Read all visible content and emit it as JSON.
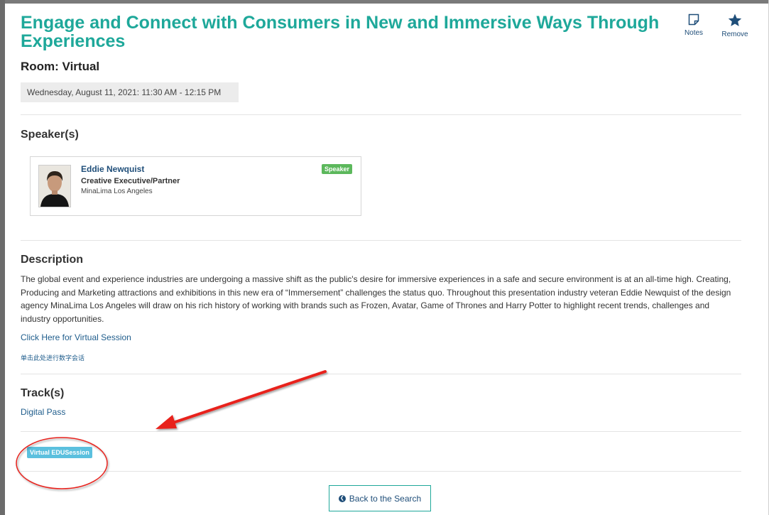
{
  "session": {
    "title": "Engage and Connect with Consumers in New and Immersive Ways Through Experiences",
    "room": "Room: Virtual",
    "datetime": "Wednesday, August 11, 2021: 11:30 AM - 12:15 PM"
  },
  "actions": {
    "notes_label": "Notes",
    "remove_label": "Remove"
  },
  "speakers": {
    "heading": "Speaker(s)",
    "items": [
      {
        "name": "Eddie Newquist",
        "role": "Creative Executive/Partner",
        "org": "MinaLima Los Angeles",
        "badge": "Speaker"
      }
    ]
  },
  "description": {
    "heading": "Description",
    "text": "The global event and experience industries are undergoing a massive shift as the public's desire for immersive experiences in a safe and secure environment is at an all-time high. Creating, Producing and Marketing attractions and exhibitions in this new era of “Immersement” challenges the status quo. Throughout this presentation industry veteran Eddie Newquist of the design agency MinaLima Los Angeles will draw on his rich history of working with brands such as Frozen, Avatar, Game of Thrones and Harry Potter to highlight recent trends, challenges and industry opportunities.",
    "virtual_link": "Click Here for Virtual Session",
    "virtual_link_cn": "单击此处进行数字会话"
  },
  "tracks": {
    "heading": "Track(s)",
    "items": [
      "Digital Pass"
    ]
  },
  "tags": [
    "Virtual EDUSession"
  ],
  "footer": {
    "back_label": "Back to the Search"
  },
  "colors": {
    "title": "#1ea89a",
    "link": "#1f5d8c",
    "speaker_badge": "#5cb85c",
    "tag_badge": "#5bc0de",
    "annotation": "#e8201c"
  },
  "icons": {
    "notes": "note-icon",
    "remove": "star-icon",
    "back": "chevron-left-circle-icon"
  }
}
